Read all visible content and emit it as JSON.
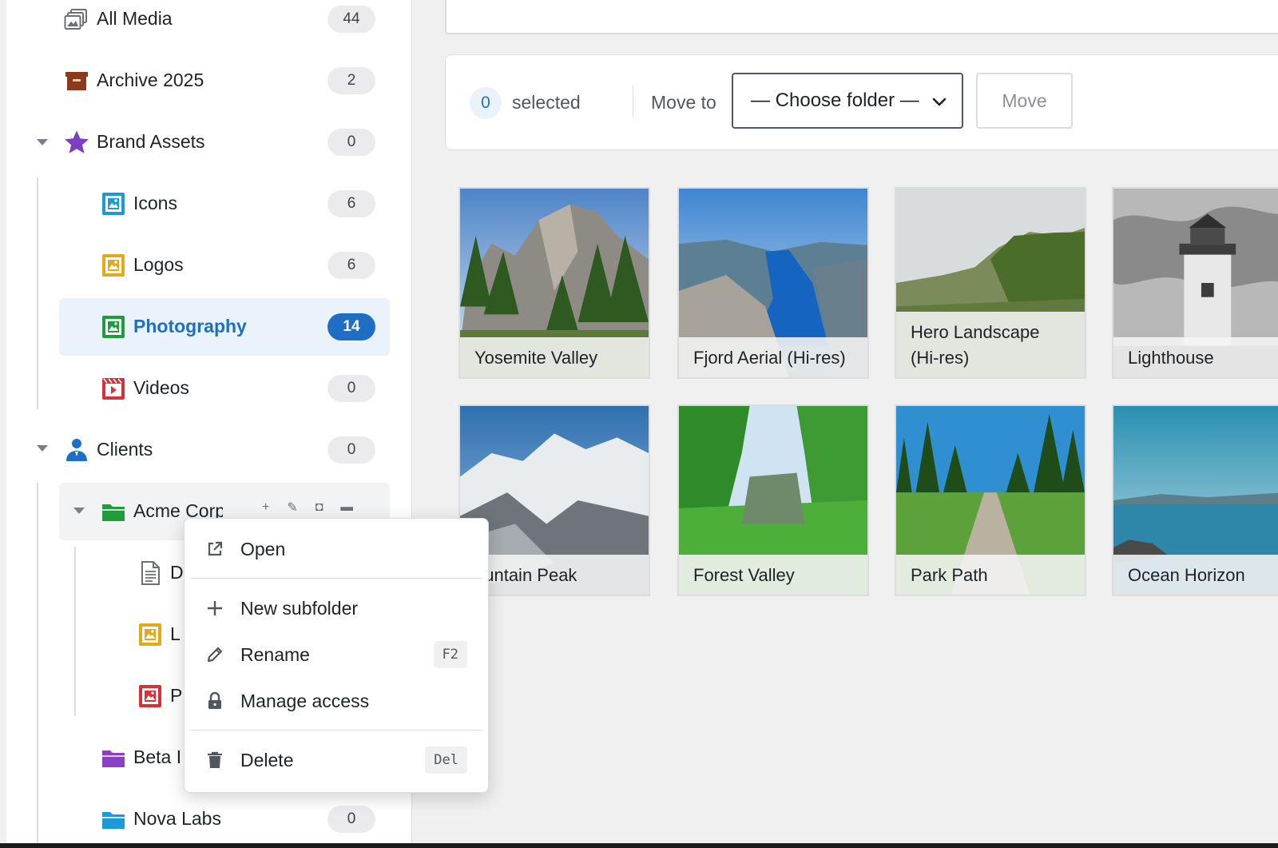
{
  "sidebar": {
    "items": [
      {
        "label": "All Media",
        "count": "44",
        "icon": "all-media-icon"
      },
      {
        "label": "Archive 2025",
        "count": "2",
        "icon": "archive-box-icon"
      },
      {
        "label": "Brand Assets",
        "count": "0",
        "icon": "star-icon"
      },
      {
        "label": "Icons",
        "count": "6",
        "icon": "image-folder-icon"
      },
      {
        "label": "Logos",
        "count": "6",
        "icon": "image-folder-icon"
      },
      {
        "label": "Photography",
        "count": "14",
        "icon": "image-folder-icon"
      },
      {
        "label": "Videos",
        "count": "0",
        "icon": "video-folder-icon"
      },
      {
        "label": "Clients",
        "count": "0",
        "icon": "person-icon"
      },
      {
        "label": "Acme Corp",
        "count": "",
        "icon": "folder-icon"
      },
      {
        "label": "D",
        "count": "",
        "icon": "document-icon"
      },
      {
        "label": "L",
        "count": "",
        "icon": "image-folder-icon"
      },
      {
        "label": "P",
        "count": "",
        "icon": "image-folder-icon"
      },
      {
        "label": "Beta I",
        "count": "",
        "icon": "folder-icon"
      },
      {
        "label": "Nova Labs",
        "count": "0",
        "icon": "folder-icon"
      }
    ],
    "active": "Photography"
  },
  "bulk": {
    "selected_count": "0",
    "selected_label": "selected",
    "move_to_label": "Move to",
    "folder_select_value": "— Choose folder —",
    "move_button": "Move"
  },
  "grid": {
    "items": [
      {
        "title": "Yosemite Valley"
      },
      {
        "title": "Fjord Aerial (Hi-res)"
      },
      {
        "title": "Hero Landscape (Hi-res)"
      },
      {
        "title": "Lighthouse"
      },
      {
        "title": "ountain Peak"
      },
      {
        "title": "Forest Valley"
      },
      {
        "title": "Park Path"
      },
      {
        "title": "Ocean Horizon"
      }
    ]
  },
  "context_menu": {
    "items": [
      {
        "label": "Open",
        "shortcut": "",
        "icon": "external-link-icon"
      },
      {
        "label": "New subfolder",
        "shortcut": "",
        "icon": "plus-icon"
      },
      {
        "label": "Rename",
        "shortcut": "F2",
        "icon": "pencil-icon"
      },
      {
        "label": "Manage access",
        "shortcut": "",
        "icon": "lock-icon"
      },
      {
        "label": "Delete",
        "shortcut": "Del",
        "icon": "trash-icon"
      }
    ]
  },
  "colors": {
    "accent": "#1e6fc4",
    "active_bg": "#eaf2fb",
    "archive": "#8b3a1c",
    "star": "#7b3fc4",
    "image_blue": "#1c9ad6",
    "image_yellow": "#e2a918",
    "image_green": "#1f9d3c",
    "video_red": "#d6303a",
    "folder_green": "#1f9d3c",
    "folder_purple": "#8a3fc4",
    "folder_cyan": "#1c9ad6"
  }
}
